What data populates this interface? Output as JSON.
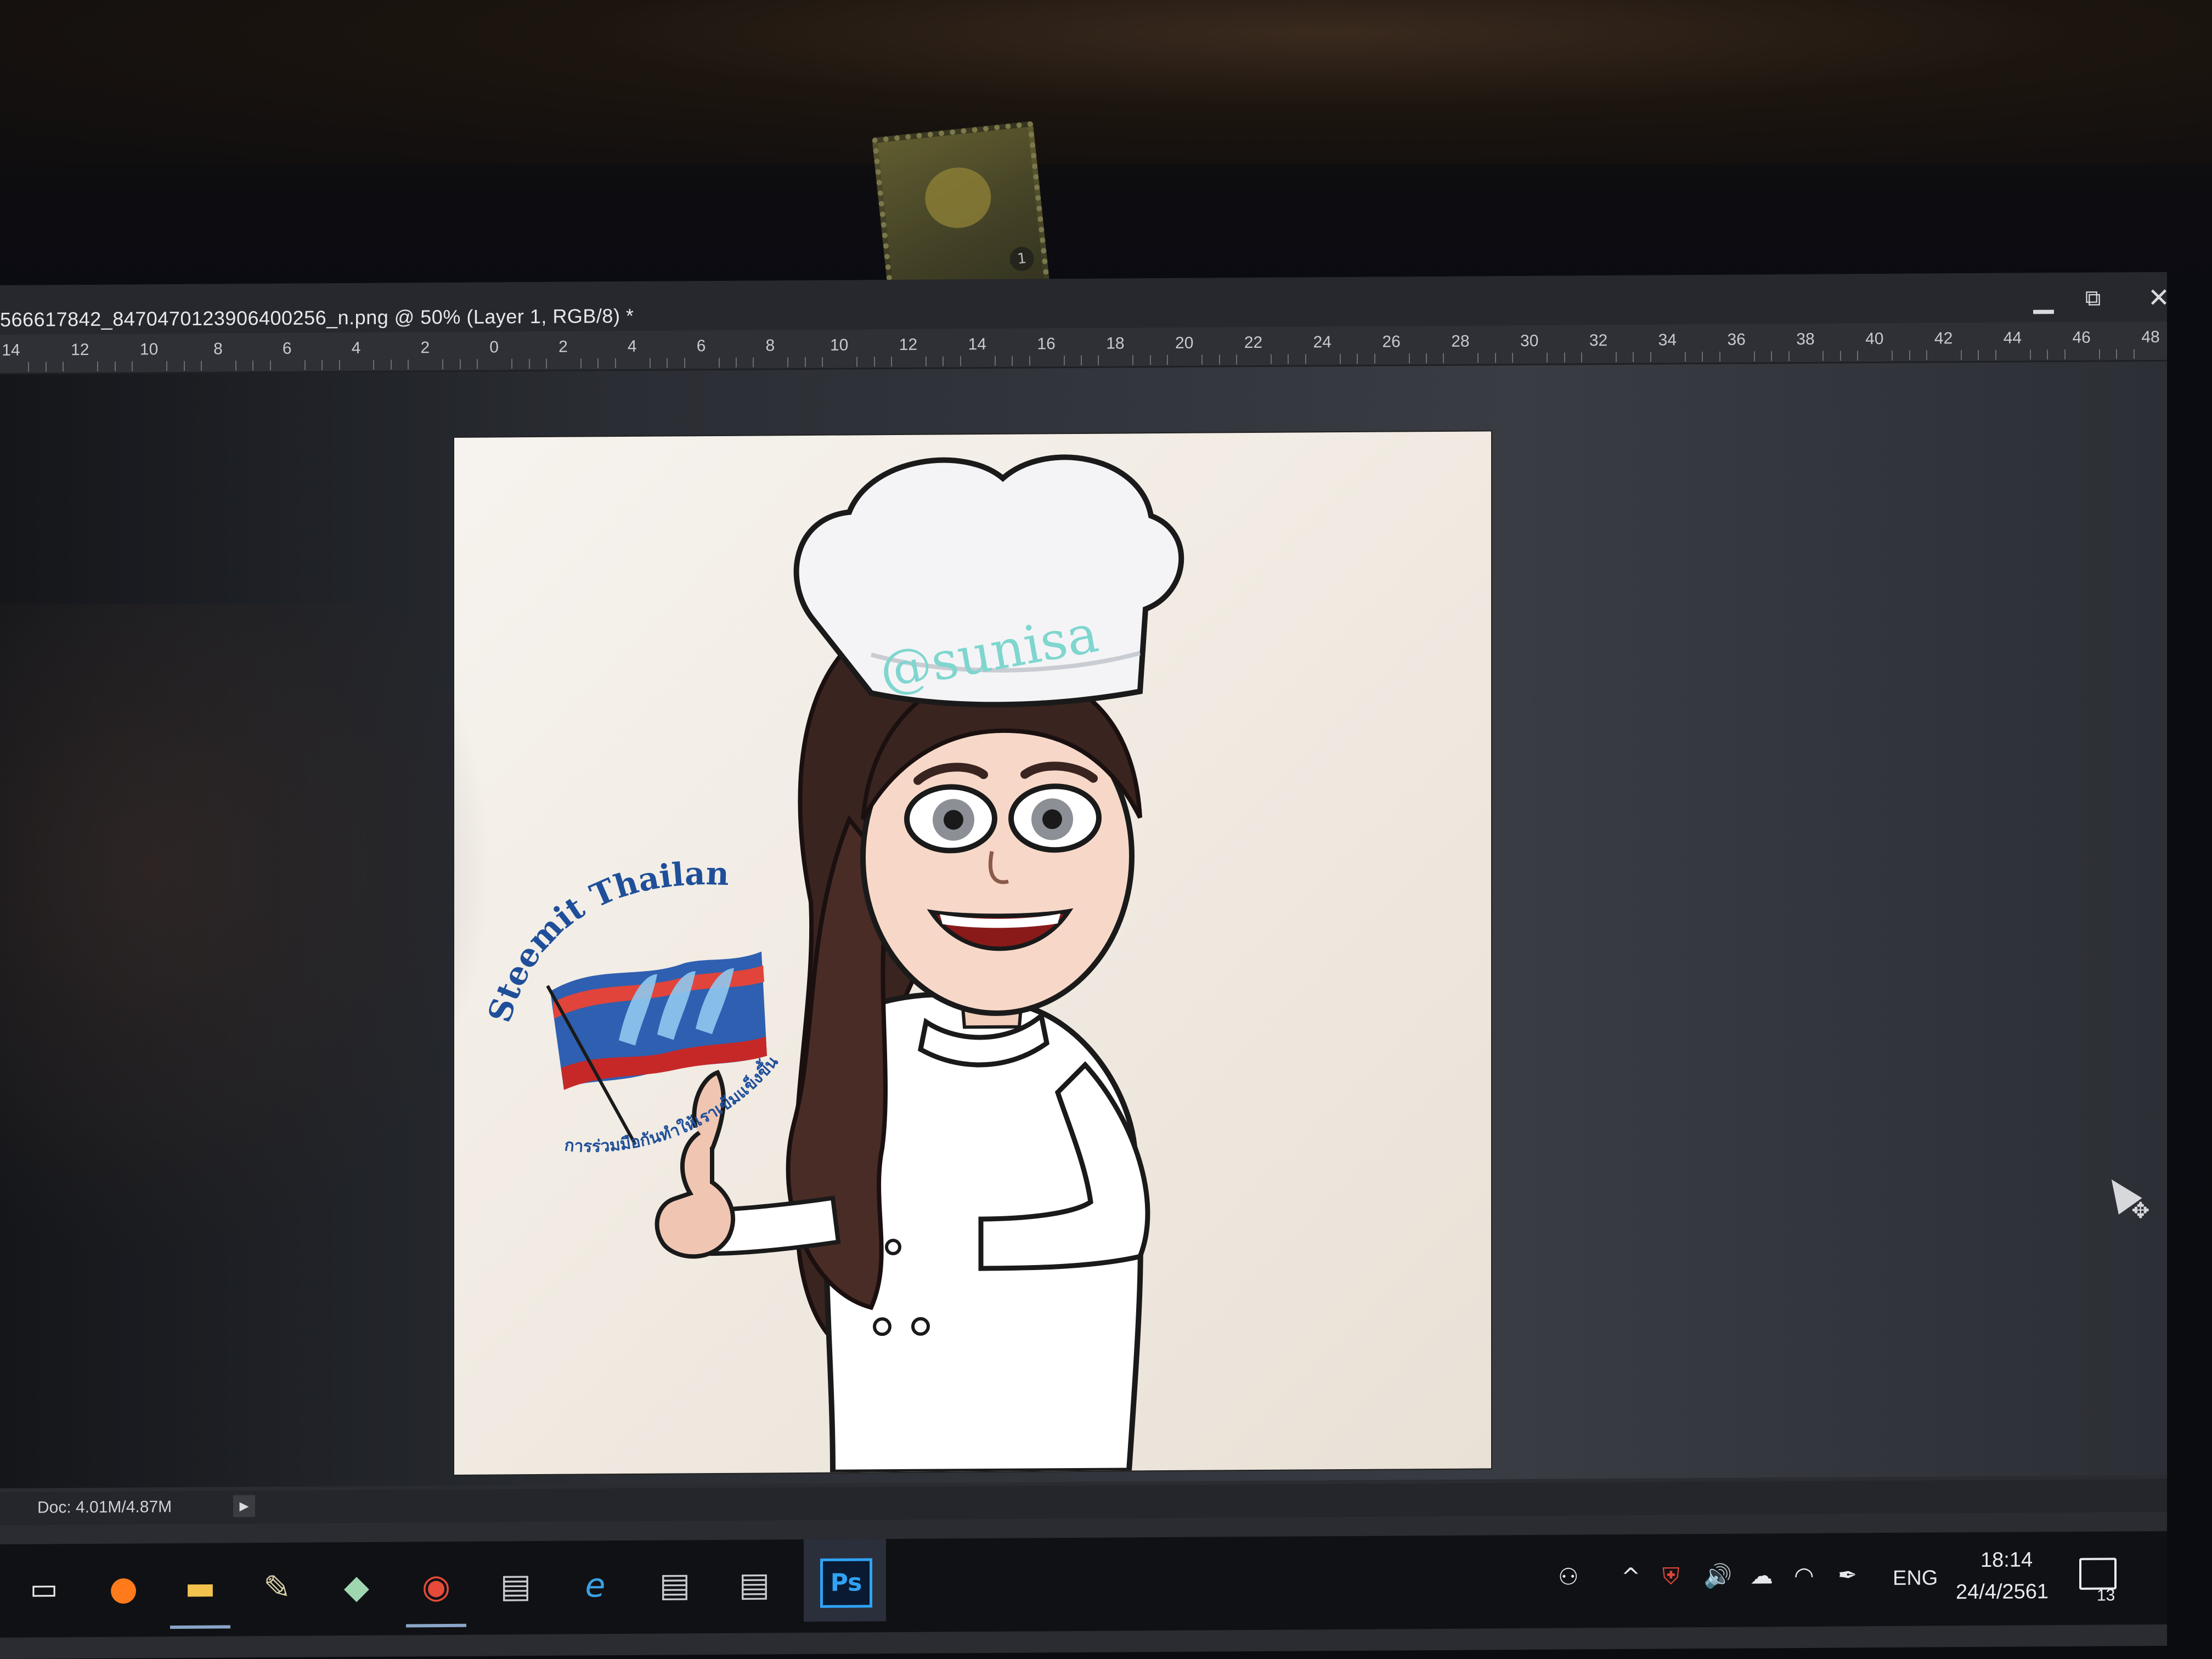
{
  "document": {
    "title": "566617842_8470470123906400256_n.png @ 50% (Layer 1, RGB/8) *"
  },
  "window_controls": {
    "minimize_icon": "minimize-icon",
    "restore_icon": "restore-icon",
    "close_icon": "close-icon"
  },
  "ruler": {
    "labels": [
      "14",
      "12",
      "10",
      "8",
      "6",
      "4",
      "2",
      "0",
      "2",
      "4",
      "6",
      "8",
      "10",
      "12",
      "14",
      "16",
      "18",
      "20",
      "22",
      "24",
      "26",
      "28",
      "30",
      "32",
      "34",
      "36",
      "38",
      "40",
      "42",
      "44",
      "46",
      "48"
    ]
  },
  "artwork": {
    "hat_text": "@sunisa",
    "logo_arc_text": "Steemit Thailand",
    "logo_thai_text": "การร่วมมือกันทำให้เราเข้มแข็งขึ้น"
  },
  "status_bar": {
    "doc_size": "Doc: 4.01M/4.87M"
  },
  "taskbar": {
    "apps": [
      {
        "name": "task-view-icon",
        "glyph": "▭"
      },
      {
        "name": "firefox-icon",
        "glyph": "●"
      },
      {
        "name": "file-explorer-icon",
        "glyph": "▬"
      },
      {
        "name": "paint-icon",
        "glyph": "✎"
      },
      {
        "name": "notes-icon",
        "glyph": "◆"
      },
      {
        "name": "chrome-icon",
        "glyph": "◉"
      },
      {
        "name": "window-app-icon",
        "glyph": "▤"
      },
      {
        "name": "internet-explorer-icon",
        "glyph": "e"
      },
      {
        "name": "window-app-2-icon",
        "glyph": "▤"
      },
      {
        "name": "window-app-3-icon",
        "glyph": "▤"
      }
    ],
    "photoshop_label": "Ps",
    "tray": {
      "language": "ENG",
      "time": "18:14",
      "date": "24/4/2561",
      "notification_count": "13"
    }
  },
  "colors": {
    "ps_accent": "#2fa3f5",
    "hat_text": "#7fd6cf",
    "logo_text": "#1f4f9a"
  }
}
